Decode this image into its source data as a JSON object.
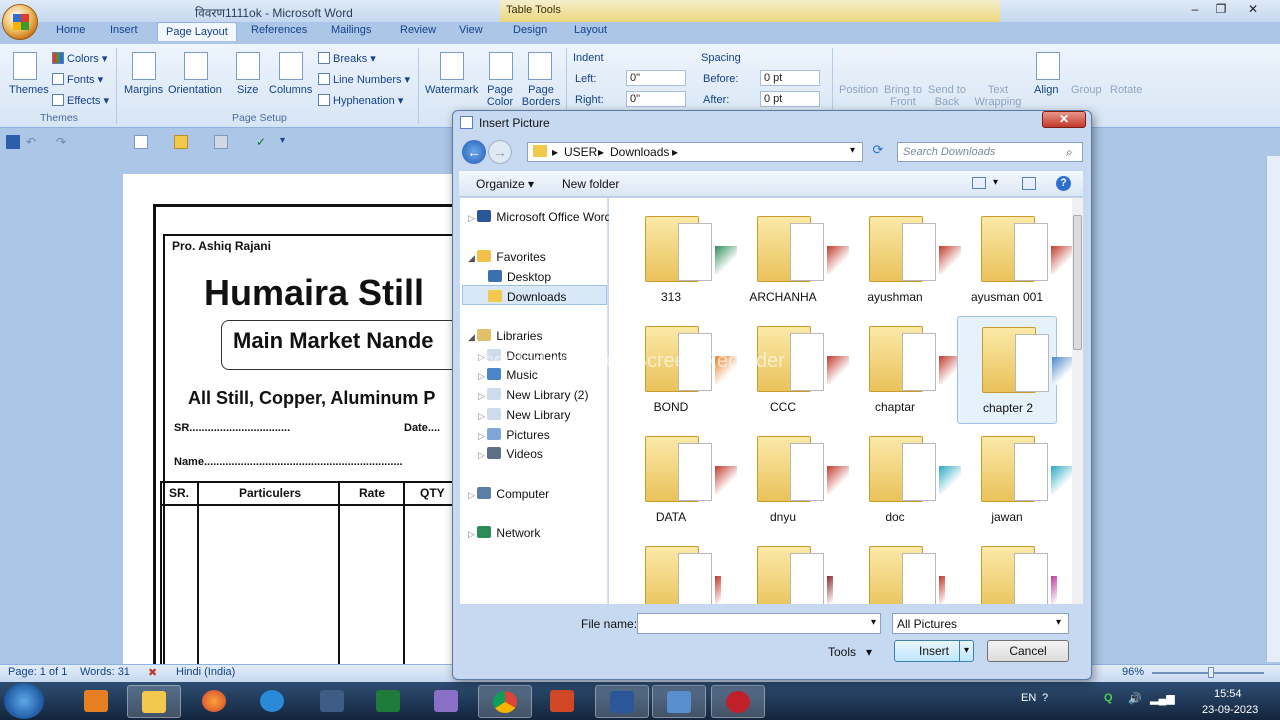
{
  "window": {
    "doc_title": "विवरण1111ok - Microsoft Word",
    "context_tab": "Table Tools",
    "controls": [
      "–",
      "❐",
      "✕"
    ]
  },
  "tabs": [
    "Home",
    "Insert",
    "Page Layout",
    "References",
    "Mailings",
    "Review",
    "View",
    "Design",
    "Layout"
  ],
  "active_tab": "Page Layout",
  "ribbon": {
    "themes": {
      "label": "Themes",
      "colors": "Colors",
      "fonts": "Fonts",
      "effects": "Effects",
      "group": "Themes"
    },
    "page_setup": {
      "margins": "Margins",
      "orientation": "Orientation",
      "size": "Size",
      "columns": "Columns",
      "breaks": "Breaks",
      "line_numbers": "Line Numbers",
      "hyphenation": "Hyphenation",
      "group": "Page Setup"
    },
    "page_background": {
      "watermark": "Watermark",
      "page_color": "Page Color",
      "page_borders": "Page Borders"
    },
    "paragraph": {
      "indent": "Indent",
      "left_label": "Left:",
      "left_value": "0\"",
      "right_label": "Right:",
      "right_value": "0\"",
      "spacing": "Spacing",
      "before_label": "Before:",
      "before_value": "0 pt",
      "after_label": "After:",
      "after_value": "0 pt"
    },
    "arrange": {
      "position": "Position",
      "bring_to_front": "Bring to Front",
      "send_to_back": "Send to Back",
      "text_wrapping": "Text Wrapping",
      "align": "Align",
      "group_btn": "Group",
      "rotate": "Rotate"
    }
  },
  "document": {
    "line1": "Pro. Ashiq Rajani",
    "heading": "Humaira Still",
    "subheading": "Main Market Nande",
    "tagline": "All Still, Copper, Aluminum P",
    "sr_field": "SR.................................",
    "date_field": "Date....",
    "name_field": "Name.................................................................",
    "table_headers": [
      "SR.",
      "Particulers",
      "Rate",
      "QTY"
    ]
  },
  "statusbar": {
    "page": "Page: 1 of 1",
    "words": "Words: 31",
    "language": "Hindi (India)",
    "zoom": "96%"
  },
  "dialog": {
    "title": "Insert Picture",
    "breadcrumb": [
      "USER",
      "Downloads"
    ],
    "search_placeholder": "Search Downloads",
    "organize": "Organize",
    "new_folder": "New folder",
    "nav": [
      {
        "label": "Microsoft Office Word"
      },
      {
        "label": "Favorites"
      },
      {
        "label": "Desktop"
      },
      {
        "label": "Downloads"
      },
      {
        "label": "Libraries"
      },
      {
        "label": "Documents"
      },
      {
        "label": "Music"
      },
      {
        "label": "New Library (2)"
      },
      {
        "label": "New Library"
      },
      {
        "label": "Pictures"
      },
      {
        "label": "Videos"
      },
      {
        "label": "Computer"
      },
      {
        "label": "Network"
      }
    ],
    "folders": [
      "313",
      "ARCHANHA",
      "ayushman",
      "ayusman 001",
      "BOND",
      "CCC",
      "chaptar",
      "chapter 2",
      "DATA",
      "dnyu",
      "doc",
      "jawan",
      "",
      "",
      "",
      ""
    ],
    "file_name_label": "File name:",
    "file_name_value": "",
    "filter": "All Pictures",
    "tools": "Tools",
    "insert": "Insert",
    "cancel": "Cancel"
  },
  "watermark_text": "Recorded with iTop Screen Recorder",
  "taskbar": {
    "lang": "EN",
    "time": "15:54",
    "date": "23-09-2023"
  }
}
